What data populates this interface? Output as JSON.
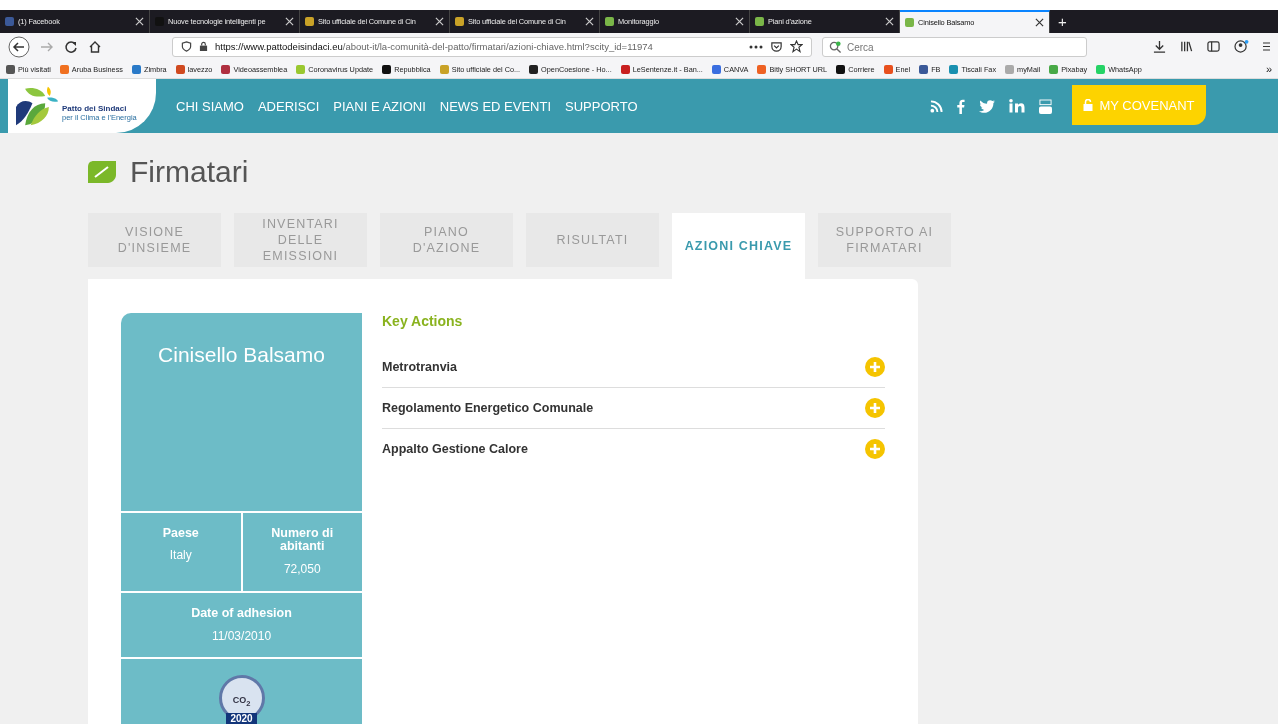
{
  "browser_tabs": [
    {
      "title": "(1) Facebook",
      "color": "#3b5998",
      "selected": false
    },
    {
      "title": "Nuove tecnologie intelligenti pe",
      "color": "#111111",
      "selected": false
    },
    {
      "title": "Sito ufficiale del Comune di Cin",
      "color": "#c9a227",
      "selected": false
    },
    {
      "title": "Sito ufficiale del Comune di Cin",
      "color": "#c9a227",
      "selected": false
    },
    {
      "title": "Monitoraggio",
      "color": "#7ab648",
      "selected": false
    },
    {
      "title": "Piani d'azione",
      "color": "#7ab648",
      "selected": false
    },
    {
      "title": "Cinisello Balsamo",
      "color": "#7ab648",
      "selected": true
    }
  ],
  "new_tab": "+",
  "address_bar": {
    "host": "https://www.pattodeisindaci.eu",
    "path": "/about-it/la-comunità-del-patto/firmatari/azioni-chiave.html?scity_id=11974"
  },
  "search": {
    "placeholder": "Cerca"
  },
  "bookmarks": [
    {
      "label": "Più visitati",
      "color": "#555555"
    },
    {
      "label": "Aruba Business",
      "color": "#f07020"
    },
    {
      "label": "Zimbra",
      "color": "#2a7ac8"
    },
    {
      "label": "lavezzo",
      "color": "#d04a20"
    },
    {
      "label": "Videoassemblea",
      "color": "#b03040"
    },
    {
      "label": "Coronavirus Update",
      "color": "#9ac830"
    },
    {
      "label": "Repubblica",
      "color": "#111111"
    },
    {
      "label": "Sito ufficiale del Co...",
      "color": "#c9a227"
    },
    {
      "label": "OpenCoesione - Ho...",
      "color": "#222222"
    },
    {
      "label": "LeSentenze.it - Ban...",
      "color": "#c82020"
    },
    {
      "label": "CANVA",
      "color": "#3a6ee0"
    },
    {
      "label": "Bitly SHORT URL",
      "color": "#ee6123"
    },
    {
      "label": "Corriere",
      "color": "#111111"
    },
    {
      "label": "Enel",
      "color": "#e8501e"
    },
    {
      "label": "FB",
      "color": "#3b5998"
    },
    {
      "label": "Tiscali Fax",
      "color": "#1a90b0"
    },
    {
      "label": "myMail",
      "color": "#aaaaaa"
    },
    {
      "label": "Pixabay",
      "color": "#48a947"
    },
    {
      "label": "WhatsApp",
      "color": "#25d366"
    }
  ],
  "bookmarks_overflow": "»",
  "site": {
    "logo_line1": "Patto dei Sindaci",
    "logo_line2": "per il Clima e l'Energia",
    "nav": [
      "CHI SIAMO",
      "ADERISCI",
      "PIANI E AZIONI",
      "NEWS ED EVENTI",
      "SUPPORTO"
    ],
    "covenant_button": "MY COVENANT"
  },
  "page_title": "Firmatari",
  "page_tabs": [
    {
      "label": "VISIONE D'INSIEME",
      "selected": false
    },
    {
      "label": "INVENTARI DELLE EMISSIONI",
      "selected": false
    },
    {
      "label": "PIANO D'AZIONE",
      "selected": false
    },
    {
      "label": "RISULTATI",
      "selected": false
    },
    {
      "label": "AZIONI CHIAVE",
      "selected": true
    },
    {
      "label": "SUPPORTO AI FIRMATARI",
      "selected": false
    }
  ],
  "city_card": {
    "name": "Cinisello Balsamo",
    "country_label": "Paese",
    "country": "Italy",
    "population_label": "Numero di abitanti",
    "population": "72,050",
    "adhesion_label": "Date of adhesion",
    "adhesion_date": "11/03/2010",
    "badge_text": "CO$_{2}$",
    "badge_year": "2020"
  },
  "key_actions": {
    "title": "Key Actions",
    "items": [
      {
        "label": "Metrotranvia",
        "expanded": false
      },
      {
        "label": "Regolamento Energetico Comunale",
        "expanded": false
      },
      {
        "label": "Appalto Gestione Calore",
        "expanded": false
      }
    ]
  }
}
